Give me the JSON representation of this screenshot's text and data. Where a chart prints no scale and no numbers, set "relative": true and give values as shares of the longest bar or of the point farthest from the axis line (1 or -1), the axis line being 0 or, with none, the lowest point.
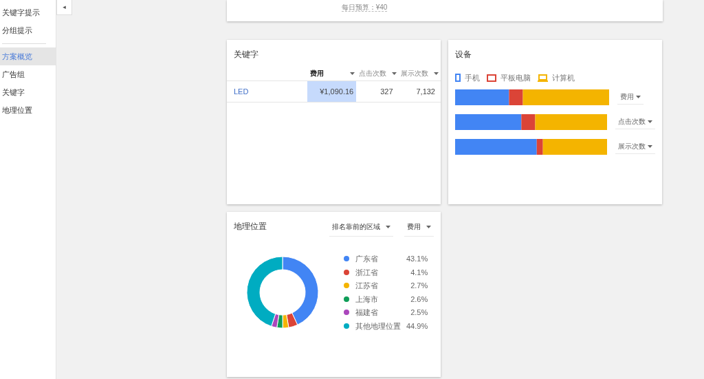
{
  "sidebar": {
    "sections": [
      [
        {
          "label": "关键字提示",
          "selected": false
        },
        {
          "label": "分组提示",
          "selected": false
        }
      ],
      [
        {
          "label": "方案概览",
          "selected": true
        },
        {
          "label": "广告组",
          "selected": false
        },
        {
          "label": "关键字",
          "selected": false
        },
        {
          "label": "地理位置",
          "selected": false
        }
      ]
    ],
    "collapse": "◂"
  },
  "budget": {
    "text": "每日预算：¥40"
  },
  "keywords": {
    "title": "关键字",
    "columns": [
      {
        "label": "费用",
        "sorted": true
      },
      {
        "label": "点击次数",
        "sorted": false
      },
      {
        "label": "展示次数",
        "sorted": false
      }
    ],
    "rows": [
      {
        "keyword": "LED",
        "cells": [
          "¥1,090.16",
          "327",
          "7,132"
        ]
      }
    ]
  },
  "devices": {
    "title": "设备",
    "legend_icons": [
      {
        "kind": "phone"
      },
      {
        "kind": "tablet"
      },
      {
        "kind": "laptop"
      }
    ],
    "chart_data": {
      "type": "bar",
      "orientation": "horizontal",
      "stacked": true,
      "relative": true,
      "categories": [
        "费用",
        "点击次数",
        "展示次数"
      ],
      "series": [
        {
          "name": "手机",
          "color": "#4285f4",
          "values": [
            0.35,
            0.43,
            0.53
          ]
        },
        {
          "name": "平板电脑",
          "color": "#db4437",
          "values": [
            0.09,
            0.09,
            0.04
          ]
        },
        {
          "name": "计算机",
          "color": "#f4b400",
          "values": [
            0.56,
            0.48,
            0.43
          ]
        }
      ]
    }
  },
  "geo": {
    "title": "地理位置",
    "filters": [
      "排名靠前的区域"
    ],
    "legend": [
      {
        "value": "43.1%",
        "color": "#4285f4"
      },
      {
        "value": "4.1%",
        "color": "#db4437"
      },
      {
        "value": "2.7%",
        "color": "#f4b400"
      },
      {
        "value": "2.6%",
        "color": "#0f9d58"
      },
      {
        "value": "2.5%",
        "color": "#ab47bc"
      },
      {
        "value": "44.9%",
        "color": "#00acc1"
      }
    ],
    "chart_data": {
      "type": "donut",
      "categories": [
        "广东省",
        "浙江省",
        "江苏省",
        "上海市",
        "福建省",
        "其他地理位置"
      ],
      "series": [
        {
          "name": "费用",
          "values": [
            43.1,
            4.1,
            2.7,
            2.6,
            2.5,
            44.9
          ]
        }
      ]
    }
  }
}
